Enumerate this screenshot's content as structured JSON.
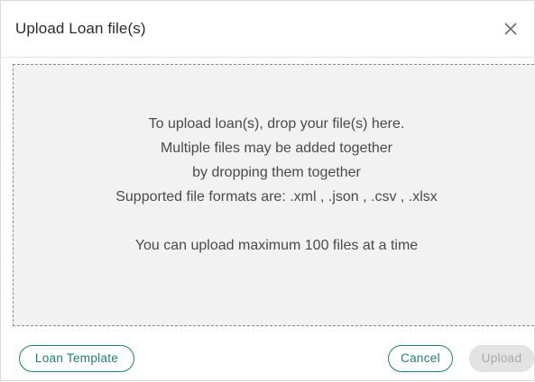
{
  "dialog": {
    "title": "Upload Loan file(s)",
    "close_icon": "close-icon"
  },
  "dropzone": {
    "lines": [
      "To upload loan(s), drop your file(s) here.",
      "Multiple files may be added together",
      "by dropping them together",
      "Supported file formats are: .xml , .json , .csv , .xlsx"
    ],
    "limit_text": "You can upload maximum 100 files at a time"
  },
  "footer": {
    "template_label": "Loan Template",
    "cancel_label": "Cancel",
    "upload_label": "Upload",
    "upload_enabled": false
  },
  "colors": {
    "accent": "#1f7f73",
    "dropzone_bg": "#f2f2f2",
    "disabled_bg": "#e3e3e3"
  }
}
